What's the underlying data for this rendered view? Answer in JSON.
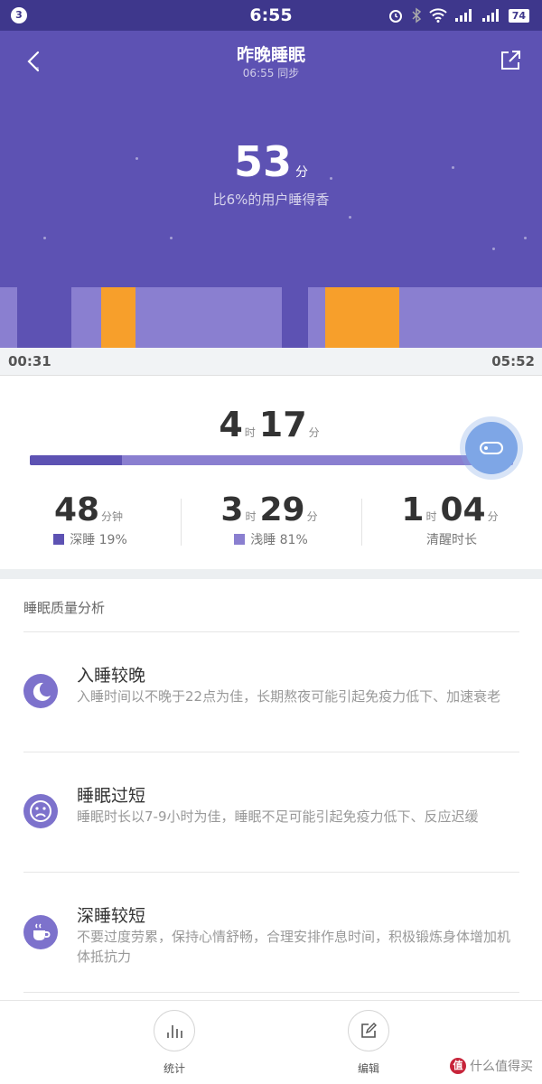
{
  "status_bar": {
    "notification_count": "3",
    "time": "6:55",
    "battery": "74"
  },
  "header": {
    "title": "昨晚睡眠",
    "subtitle": "06:55 同步",
    "score": "53",
    "score_unit": "分",
    "score_desc": "比6%的用户睡得香"
  },
  "timeline": {
    "start": "00:31",
    "end": "05:52",
    "segments": [
      {
        "type": "light",
        "from": 0.0,
        "to": 0.032
      },
      {
        "type": "deep",
        "from": 0.032,
        "to": 0.132
      },
      {
        "type": "light",
        "from": 0.132,
        "to": 0.187
      },
      {
        "type": "awake",
        "from": 0.187,
        "to": 0.25
      },
      {
        "type": "light",
        "from": 0.25,
        "to": 0.52
      },
      {
        "type": "deep",
        "from": 0.52,
        "to": 0.568
      },
      {
        "type": "light",
        "from": 0.568,
        "to": 0.6
      },
      {
        "type": "awake",
        "from": 0.6,
        "to": 0.737
      },
      {
        "type": "light",
        "from": 0.737,
        "to": 1.0
      }
    ]
  },
  "summary": {
    "total_hours": "4",
    "hour_unit": "时",
    "total_minutes": "17",
    "minute_unit": "分",
    "deep_fraction": 0.19,
    "deep": {
      "value": "48",
      "unit": "分钟",
      "label": "深睡 19%"
    },
    "light": {
      "hours": "3",
      "hour_unit": "时",
      "minutes": "29",
      "minute_unit": "分",
      "label": "浅睡 81%"
    },
    "awake": {
      "hours": "1",
      "hour_unit": "时",
      "minutes": "04",
      "minute_unit": "分",
      "label": "清醒时长"
    }
  },
  "analysis": {
    "title": "睡眠质量分析",
    "items": [
      {
        "icon": "moon-icon",
        "title": "入睡较晚",
        "desc": "入睡时间以不晚于22点为佳，长期熬夜可能引起免疫力低下、加速衰老"
      },
      {
        "icon": "sad-face-icon",
        "title": "睡眠过短",
        "desc": "睡眠时长以7-9小时为佳，睡眠不足可能引起免疫力低下、反应迟缓"
      },
      {
        "icon": "coffee-cup-icon",
        "title": "深睡较短",
        "desc": "不要过度劳累，保持心情舒畅，合理安排作息时间，积极锻炼身体增加机体抵抗力"
      }
    ]
  },
  "bottom_bar": {
    "stats_label": "统计",
    "edit_label": "编辑"
  },
  "watermark": {
    "text": "什么值得买",
    "badge": "值"
  },
  "colors": {
    "header_bg": "#5d52b3",
    "deep": "#5d52b3",
    "light": "#8a7fd0",
    "awake": "#f79f2b"
  }
}
